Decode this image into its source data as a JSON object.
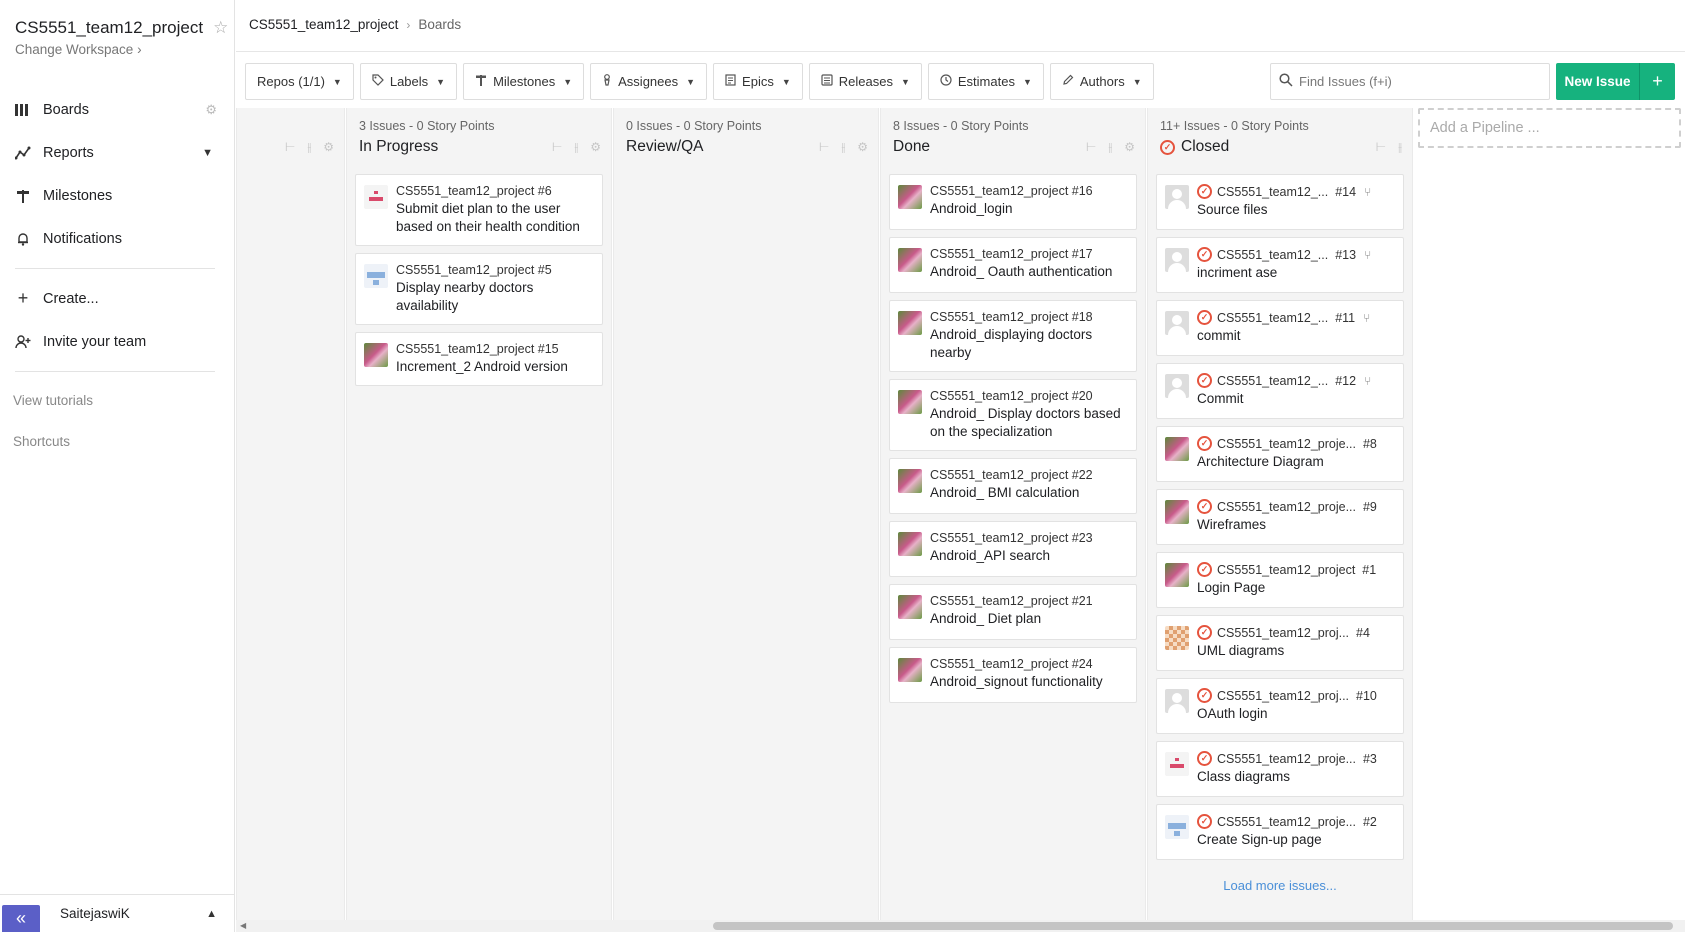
{
  "workspace": {
    "title": "CS5551_team12_project",
    "change_label": "Change Workspace",
    "change_chevron": "›"
  },
  "sidebar": {
    "items": [
      {
        "label": "Boards"
      },
      {
        "label": "Reports"
      },
      {
        "label": "Milestones"
      },
      {
        "label": "Notifications"
      }
    ],
    "actions": [
      {
        "label": "Create..."
      },
      {
        "label": "Invite your team"
      }
    ],
    "links": [
      {
        "label": "View tutorials"
      },
      {
        "label": "Shortcuts"
      }
    ],
    "collapse_label": "«",
    "user_name": "SaitejaswiK"
  },
  "breadcrumb": {
    "project": "CS5551_team12_project",
    "current": "Boards"
  },
  "filters": {
    "repos": "Repos (1/1)",
    "labels": "Labels",
    "milestones": "Milestones",
    "assignees": "Assignees",
    "epics": "Epics",
    "releases": "Releases",
    "estimates": "Estimates",
    "authors": "Authors"
  },
  "search": {
    "placeholder": "Find Issues (f+i)"
  },
  "new_issue": {
    "label": "New Issue",
    "plus": "+"
  },
  "pipelines": {
    "in_progress": {
      "meta": "3 Issues - 0 Story Points",
      "title": "In Progress",
      "cards": [
        {
          "ref": "CS5551_team12_project #6",
          "title": "Submit diet plan to the user based on their health condition"
        },
        {
          "ref": "CS5551_team12_project #5",
          "title": "Display nearby doctors availability"
        },
        {
          "ref": "CS5551_team12_project #15",
          "title": "Increment_2 Android version"
        }
      ]
    },
    "review": {
      "meta": "0 Issues - 0 Story Points",
      "title": "Review/QA"
    },
    "done": {
      "meta": "8 Issues - 0 Story Points",
      "title": "Done",
      "cards": [
        {
          "ref": "CS5551_team12_project #16",
          "title": "Android_login"
        },
        {
          "ref": "CS5551_team12_project #17",
          "title": "Android_ Oauth authentication"
        },
        {
          "ref": "CS5551_team12_project #18",
          "title": "Android_displaying doctors nearby"
        },
        {
          "ref": "CS5551_team12_project #20",
          "title": "Android_ Display doctors based on the specialization"
        },
        {
          "ref": "CS5551_team12_project #22",
          "title": "Android_ BMI calculation"
        },
        {
          "ref": "CS5551_team12_project #23",
          "title": "Android_API search"
        },
        {
          "ref": "CS5551_team12_project #21",
          "title": "Android_ Diet plan"
        },
        {
          "ref": "CS5551_team12_project #24",
          "title": "Android_signout functionality"
        }
      ]
    },
    "closed": {
      "meta": "11+ Issues - 0 Story Points",
      "title": "Closed",
      "cards": [
        {
          "repo": "CS5551_team12_...",
          "num": "#14",
          "title": "Source files"
        },
        {
          "repo": "CS5551_team12_...",
          "num": "#13",
          "title": "incriment ase"
        },
        {
          "repo": "CS5551_team12_...",
          "num": "#11",
          "title": "commit"
        },
        {
          "repo": "CS5551_team12_...",
          "num": "#12",
          "title": "Commit"
        },
        {
          "repo": "CS5551_team12_proje...",
          "num": "#8",
          "title": "Architecture Diagram"
        },
        {
          "repo": "CS5551_team12_proje...",
          "num": "#9",
          "title": "Wireframes"
        },
        {
          "repo": "CS5551_team12_project",
          "num": "#1",
          "title": "Login Page"
        },
        {
          "repo": "CS5551_team12_proj...",
          "num": "#4",
          "title": "UML diagrams"
        },
        {
          "repo": "CS5551_team12_proj...",
          "num": "#10",
          "title": "OAuth login"
        },
        {
          "repo": "CS5551_team12_proje...",
          "num": "#3",
          "title": "Class diagrams"
        },
        {
          "repo": "CS5551_team12_proje...",
          "num": "#2",
          "title": "Create Sign-up page"
        }
      ],
      "load_more": "Load more issues..."
    }
  },
  "add_pipeline": "Add a Pipeline ...",
  "colors": {
    "accent": "#16b27e",
    "closed": "#e5533d",
    "collapse": "#5b5fc7",
    "link": "#4a8fd8"
  },
  "icons": [
    "star-icon",
    "boards-icon",
    "reports-icon",
    "milestones-icon",
    "bell-icon",
    "plus-icon",
    "add-user-icon",
    "gear-icon",
    "chevron-down-icon",
    "search-icon",
    "closed-issue-icon",
    "pull-request-icon"
  ]
}
